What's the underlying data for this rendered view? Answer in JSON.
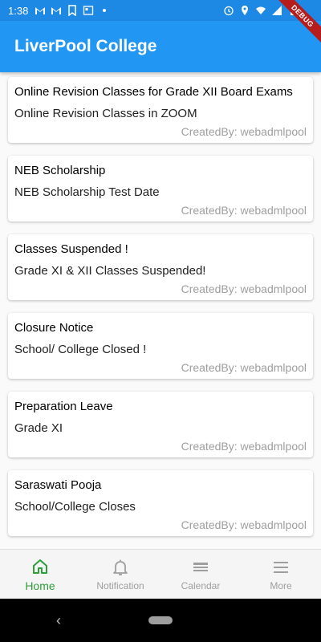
{
  "status_bar": {
    "time": "1:38"
  },
  "debug_banner": "DEBUG",
  "app_bar": {
    "title": "LiverPool College"
  },
  "notices": [
    {
      "title": "Online Revision Classes for Grade XII Board Exams",
      "subtitle": "Online Revision Classes in ZOOM",
      "author": "CreatedBy: webadmlpool"
    },
    {
      "title": "NEB Scholarship",
      "subtitle": "NEB Scholarship Test Date",
      "author": "CreatedBy: webadmlpool"
    },
    {
      "title": "Classes Suspended !",
      "subtitle": "Grade XI & XII Classes Suspended!",
      "author": "CreatedBy: webadmlpool"
    },
    {
      "title": "Closure Notice",
      "subtitle": "School/ College Closed !",
      "author": "CreatedBy: webadmlpool"
    },
    {
      "title": "Preparation Leave",
      "subtitle": "Grade XI",
      "author": "CreatedBy: webadmlpool"
    },
    {
      "title": "Saraswati Pooja",
      "subtitle": "School/College Closes",
      "author": "CreatedBy: webadmlpool"
    }
  ],
  "bottom_nav": [
    {
      "label": "Home",
      "icon": "home-icon",
      "active": true
    },
    {
      "label": "Notification",
      "icon": "bell-icon",
      "active": false
    },
    {
      "label": "Calendar",
      "icon": "calendar-icon",
      "active": false
    },
    {
      "label": "More",
      "icon": "menu-icon",
      "active": false
    }
  ],
  "colors": {
    "primary": "#2196f3",
    "active_nav": "#2e9d3b",
    "inactive_nav": "#9e9e9e"
  }
}
